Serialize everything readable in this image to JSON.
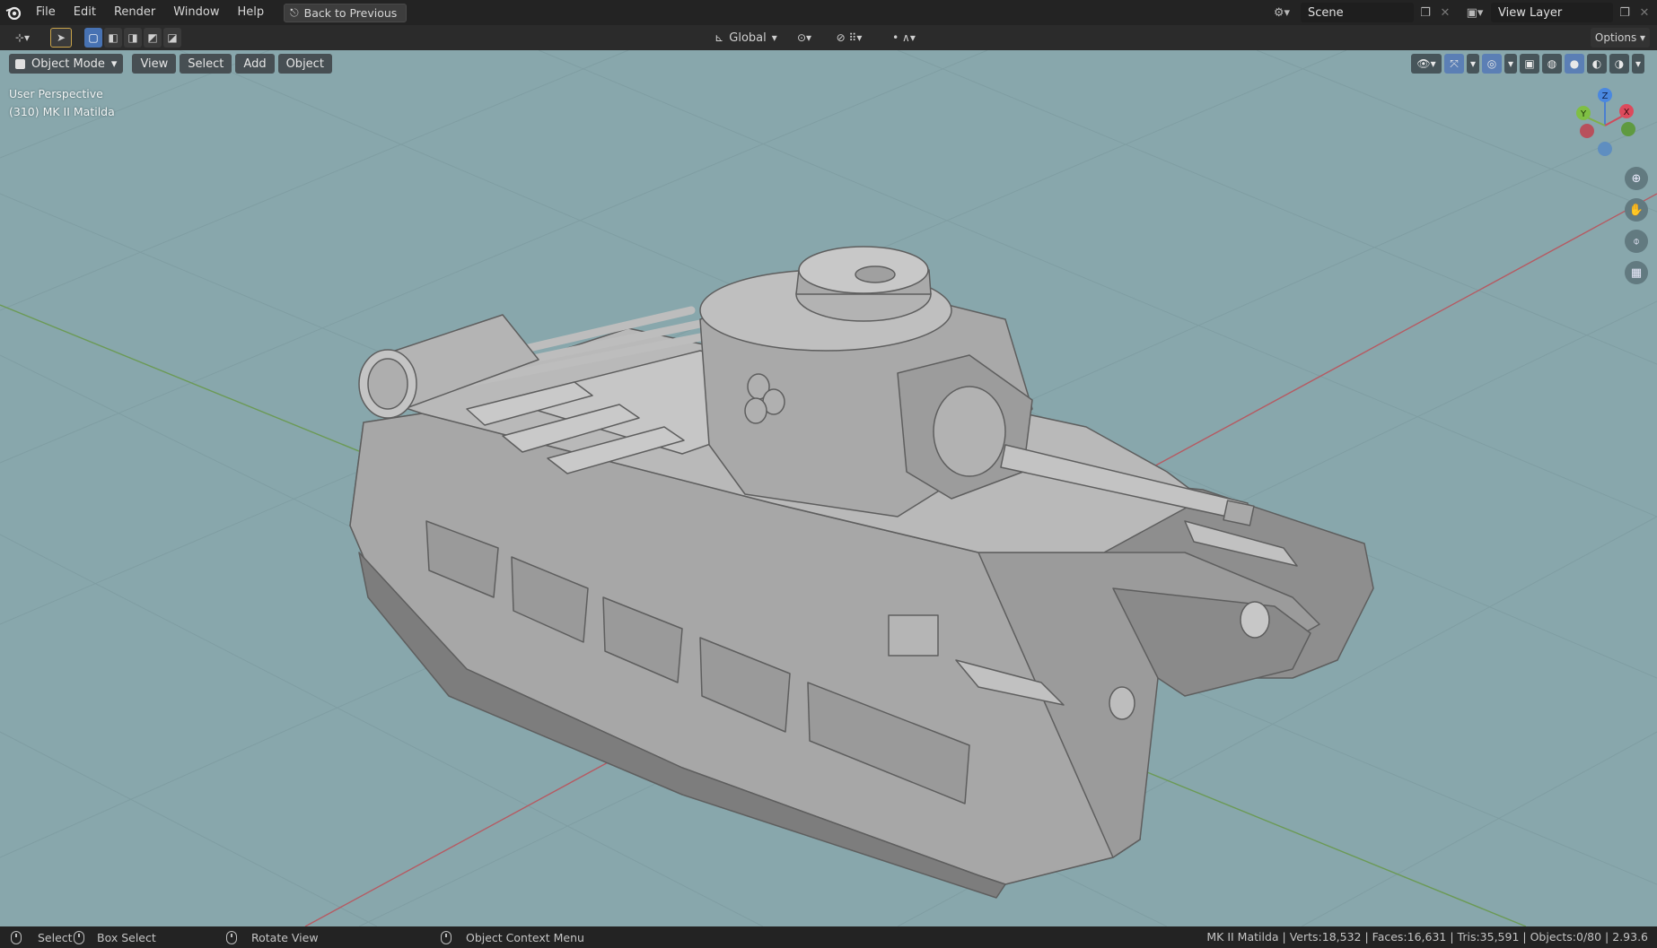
{
  "menu": {
    "items": [
      "File",
      "Edit",
      "Render",
      "Window",
      "Help"
    ],
    "back_button": "Back to Previous"
  },
  "scene": {
    "label": "Scene"
  },
  "view_layer": {
    "label": "View Layer"
  },
  "toolheader": {
    "transform_orientation": "Global",
    "options_label": "Options"
  },
  "viewport_header": {
    "mode": "Object Mode",
    "view": "View",
    "select": "Select",
    "add": "Add",
    "object": "Object"
  },
  "viewport": {
    "perspective": "User Perspective",
    "active_object": "(310) MK II Matilda",
    "background_color": "#88a7ac"
  },
  "gizmo": {
    "z": "Z",
    "y": "Y",
    "x": "X"
  },
  "statusbar": {
    "select": "Select",
    "box_select": "Box Select",
    "rotate_view": "Rotate View",
    "context_menu": "Object Context Menu",
    "stats": "MK II Matilda | Verts:18,532 | Faces:16,631 | Tris:35,591 | Objects:0/80 | 2.93.6"
  },
  "icons": [
    "blender-logo-icon",
    "back-icon",
    "scene-icon",
    "view-layer-icon",
    "editor-type-icon",
    "cursor-tool-icon",
    "transform-orientation-icon",
    "pivot-icon",
    "snap-icon",
    "proportional-icon",
    "visibility-icon",
    "gizmo-toggle-icon",
    "overlay-icon",
    "xray-icon",
    "wireframe-shading-icon",
    "solid-shading-icon",
    "material-shading-icon",
    "rendered-shading-icon",
    "zoom-icon",
    "pan-icon",
    "camera-icon",
    "ortho-grid-icon"
  ]
}
